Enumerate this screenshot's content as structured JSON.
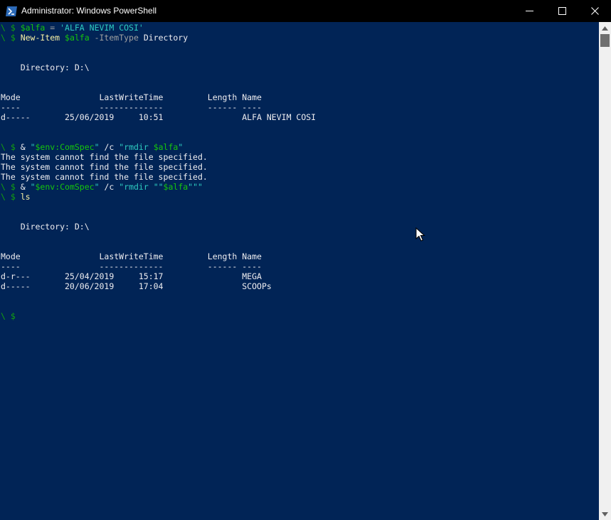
{
  "window": {
    "title": "Administrator: Windows PowerShell"
  },
  "icons": {
    "app": "powershell-icon",
    "minimize": "minimize-icon",
    "maximize": "maximize-icon",
    "close": "close-icon",
    "pointer": "mouse-pointer-icon"
  },
  "colors": {
    "background": "#012456",
    "prompt": "#13a10e",
    "command": "#f9f1a5",
    "variable": "#16c60c",
    "string": "#2ecbc0",
    "parameter": "#a0a0a0",
    "text": "#eeedf0"
  },
  "console": {
    "lines": [
      [
        {
          "t": "\\ $ ",
          "c": "g"
        },
        {
          "t": "$alfa",
          "c": "g2"
        },
        {
          "t": " = ",
          "c": "gr"
        },
        {
          "t": "'ALFA NEVIM COSI'",
          "c": "t"
        }
      ],
      [
        {
          "t": "\\ $ ",
          "c": "g"
        },
        {
          "t": "New-Item",
          "c": "y"
        },
        {
          "t": " ",
          "c": "w"
        },
        {
          "t": "$alfa",
          "c": "g2"
        },
        {
          "t": " -ItemType",
          "c": "gr"
        },
        {
          "t": " Directory",
          "c": "w"
        }
      ],
      [],
      [],
      [
        {
          "t": "    Directory: D:\\",
          "c": "w"
        }
      ],
      [],
      [],
      [
        {
          "t": "Mode                LastWriteTime         Length Name",
          "c": "w"
        }
      ],
      [
        {
          "t": "----                -------------         ------ ----",
          "c": "w"
        }
      ],
      [
        {
          "t": "d-----       25/06/2019     10:51                ALFA NEVIM COSI",
          "c": "w"
        }
      ],
      [],
      [],
      [
        {
          "t": "\\ $ ",
          "c": "g"
        },
        {
          "t": "& ",
          "c": "w"
        },
        {
          "t": "\"",
          "c": "t"
        },
        {
          "t": "$env:ComSpec",
          "c": "g2"
        },
        {
          "t": "\"",
          "c": "t"
        },
        {
          "t": " /c ",
          "c": "w"
        },
        {
          "t": "\"rmdir ",
          "c": "t"
        },
        {
          "t": "$alfa",
          "c": "g2"
        },
        {
          "t": "\"",
          "c": "t"
        }
      ],
      [
        {
          "t": "The system cannot find the file specified.",
          "c": "w"
        }
      ],
      [
        {
          "t": "The system cannot find the file specified.",
          "c": "w"
        }
      ],
      [
        {
          "t": "The system cannot find the file specified.",
          "c": "w"
        }
      ],
      [
        {
          "t": "\\ $ ",
          "c": "g"
        },
        {
          "t": "& ",
          "c": "w"
        },
        {
          "t": "\"",
          "c": "t"
        },
        {
          "t": "$env:ComSpec",
          "c": "g2"
        },
        {
          "t": "\"",
          "c": "t"
        },
        {
          "t": " /c ",
          "c": "w"
        },
        {
          "t": "\"rmdir \"\"",
          "c": "t"
        },
        {
          "t": "$alfa",
          "c": "g2"
        },
        {
          "t": "\"\"\"",
          "c": "t"
        }
      ],
      [
        {
          "t": "\\ $ ",
          "c": "g"
        },
        {
          "t": "ls",
          "c": "y"
        }
      ],
      [],
      [],
      [
        {
          "t": "    Directory: D:\\",
          "c": "w"
        }
      ],
      [],
      [],
      [
        {
          "t": "Mode                LastWriteTime         Length Name",
          "c": "w"
        }
      ],
      [
        {
          "t": "----                -------------         ------ ----",
          "c": "w"
        }
      ],
      [
        {
          "t": "d-r---       25/04/2019     15:17                MEGA",
          "c": "w"
        }
      ],
      [
        {
          "t": "d-----       20/06/2019     17:04                SCOOPs",
          "c": "w"
        }
      ],
      [],
      [],
      [
        {
          "t": "\\ $",
          "c": "g"
        }
      ]
    ]
  }
}
